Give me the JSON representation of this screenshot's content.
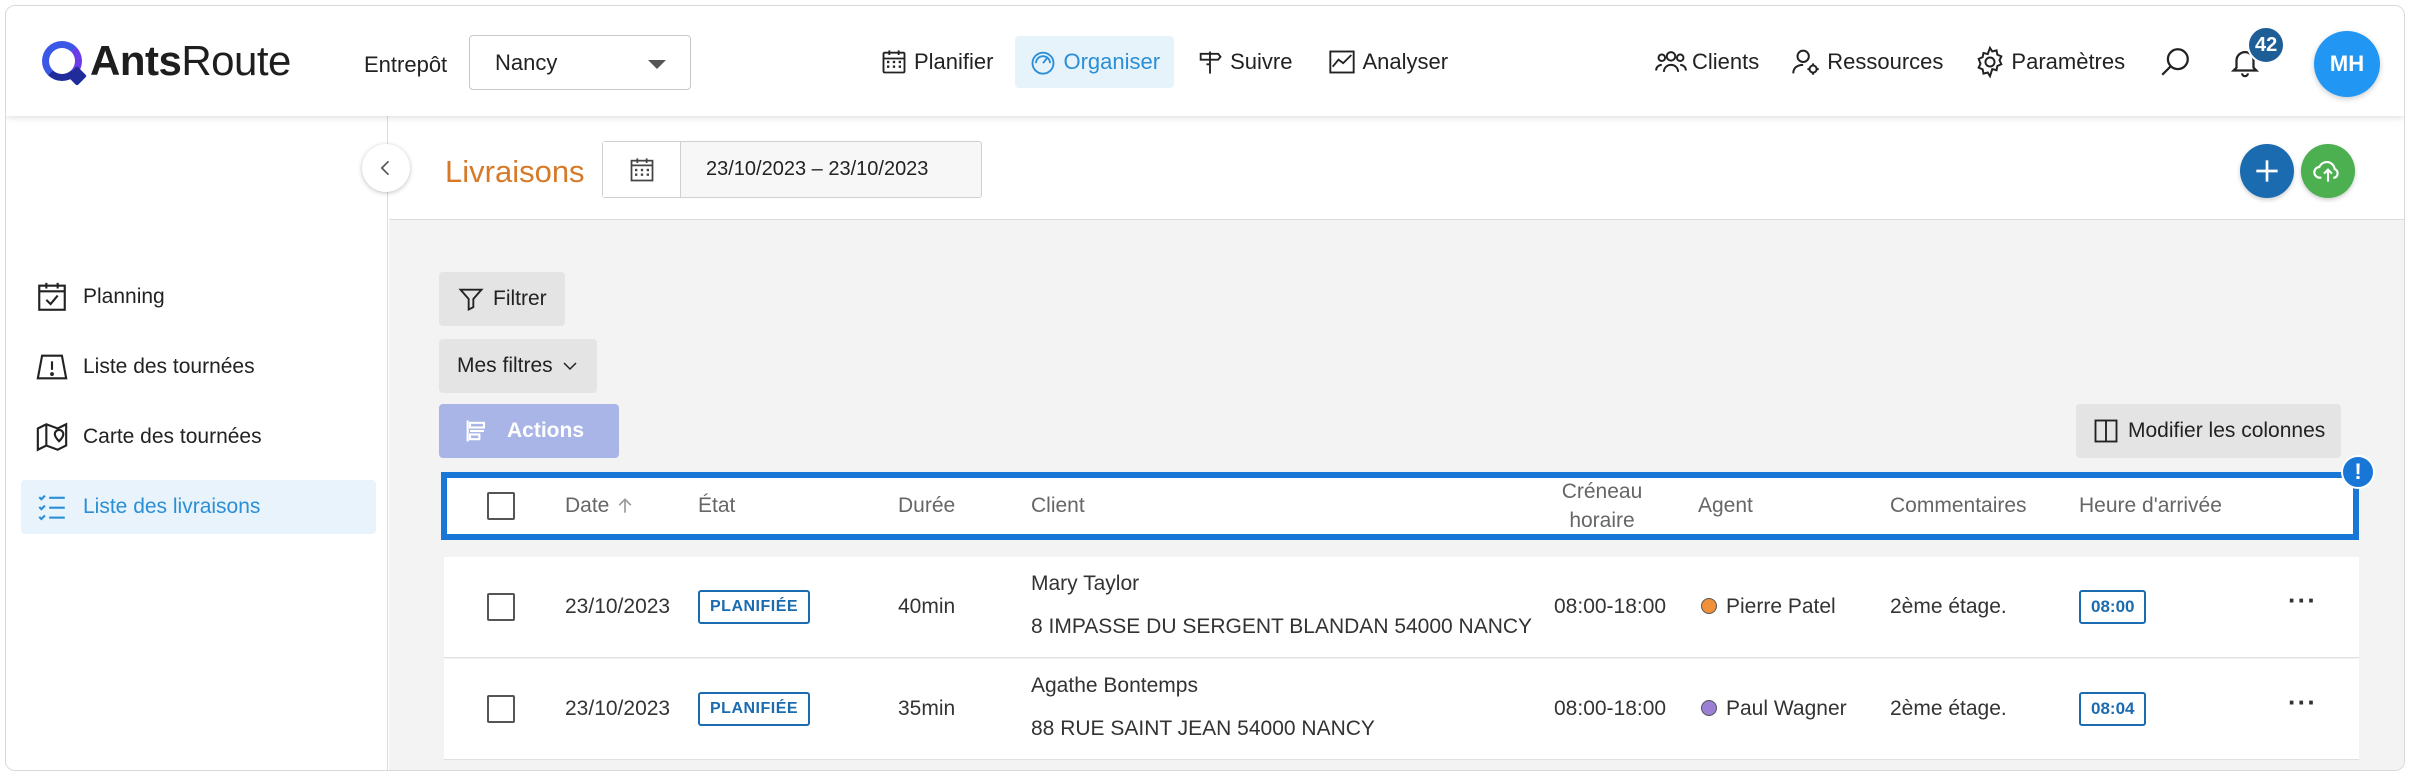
{
  "header": {
    "logo": {
      "bold": "Ants",
      "regular": "Route"
    },
    "warehouse_label": "Entrepôt",
    "warehouse_value": "Nancy",
    "nav": [
      {
        "label": "Planifier",
        "icon": "calendar-icon",
        "active": false
      },
      {
        "label": "Organiser",
        "icon": "speedometer-icon",
        "active": true
      },
      {
        "label": "Suivre",
        "icon": "signpost-icon",
        "active": false
      },
      {
        "label": "Analyser",
        "icon": "chart-icon",
        "active": false
      }
    ],
    "right_nav": [
      {
        "label": "Clients",
        "icon": "users-icon"
      },
      {
        "label": "Ressources",
        "icon": "user-gear-icon"
      },
      {
        "label": "Paramètres",
        "icon": "gear-icon"
      }
    ],
    "notifications_count": "42",
    "avatar_initials": "MH"
  },
  "sidebar": {
    "items": [
      {
        "label": "Planning",
        "icon": "calendar-check-icon",
        "active": false
      },
      {
        "label": "Liste des tournées",
        "icon": "route-warning-icon",
        "active": false
      },
      {
        "label": "Carte des tournées",
        "icon": "map-icon",
        "active": false
      },
      {
        "label": "Liste des livraisons",
        "icon": "list-check-icon",
        "active": true
      }
    ]
  },
  "main": {
    "title": "Livraisons",
    "date_range": "23/10/2023 – 23/10/2023",
    "filter_label": "Filtrer",
    "my_filters_label": "Mes filtres",
    "actions_label": "Actions",
    "edit_columns_label": "Modifier les colonnes",
    "warning_mark": "!",
    "table": {
      "columns": {
        "date": "Date",
        "state": "État",
        "duration": "Durée",
        "client": "Client",
        "slot": "Créneau horaire",
        "agent": "Agent",
        "comments": "Commentaires",
        "arrival": "Heure d'arrivée"
      },
      "rows": [
        {
          "date": "23/10/2023",
          "state": "PLANIFIÉE",
          "duration": "40min",
          "client_name": "Mary Taylor",
          "client_address": "8 IMPASSE DU SERGENT BLANDAN 54000 NANCY",
          "slot": "08:00-18:00",
          "agent": "Pierre Patel",
          "agent_color": "#f0913a",
          "comment": "2ème étage.",
          "arrival": "08:00",
          "more": "···"
        },
        {
          "date": "23/10/2023",
          "state": "PLANIFIÉE",
          "duration": "35min",
          "client_name": "Agathe Bontemps",
          "client_address": "88 RUE SAINT JEAN 54000 NANCY",
          "slot": "08:00-18:00",
          "agent": "Paul Wagner",
          "agent_color": "#9b7fd4",
          "comment": "2ème étage.",
          "arrival": "08:04",
          "more": "···"
        }
      ]
    }
  },
  "colors": {
    "accent": "#2a8fd6",
    "title": "#d67a2a",
    "primary_blue": "#1b6bb0",
    "green": "#4caf50",
    "highlight": "#1877d6"
  }
}
